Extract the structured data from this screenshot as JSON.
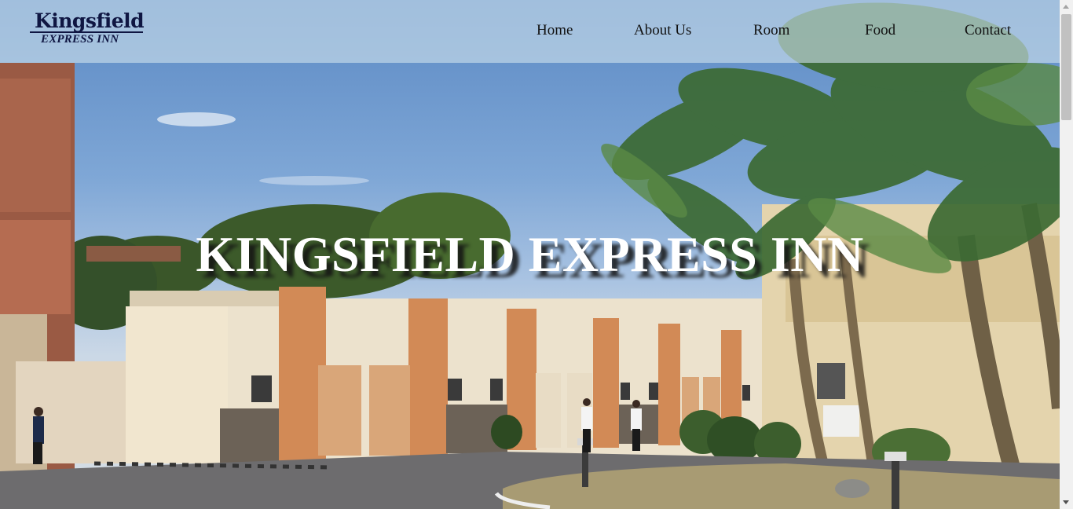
{
  "brand": {
    "name": "Kingsfield",
    "subtitle": "EXPRESS INN",
    "color": "#0f1642"
  },
  "nav": {
    "items": [
      {
        "label": "Home"
      },
      {
        "label": "About Us"
      },
      {
        "label": "Room"
      },
      {
        "label": "Food"
      },
      {
        "label": "Contact"
      }
    ]
  },
  "hero": {
    "title": "KINGSFIELD EXPRESS INN",
    "image": "hotel-courtyard-with-palm-trees"
  },
  "colors": {
    "navbar_overlay": "#cde1eb",
    "title_text": "#ffffff"
  }
}
